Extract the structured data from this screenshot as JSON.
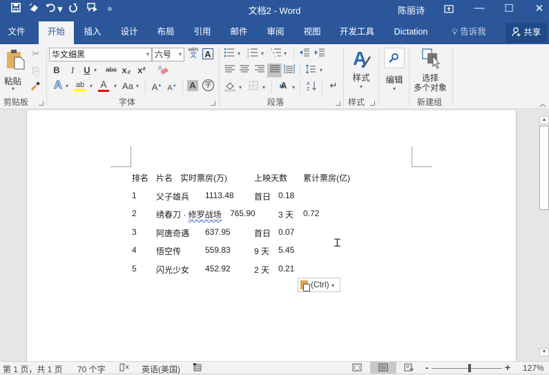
{
  "window": {
    "doc_name": "文档2",
    "separator": "-",
    "app_name": "Word",
    "user": "陈丽诗",
    "ribbon_display_icon": "ribbon-display-options-icon",
    "minimize": "—",
    "maximize": "☐",
    "close": "✕"
  },
  "qat": {
    "save": "save-icon",
    "touch_mode": "touch-mode-icon",
    "undo": "undo-icon",
    "redo": "redo-icon",
    "read_aloud": "read-aloud-icon",
    "customize": "customize-qat-icon"
  },
  "tabs": [
    {
      "label": "文件",
      "active": false
    },
    {
      "label": "开始",
      "active": true
    },
    {
      "label": "插入",
      "active": false
    },
    {
      "label": "设计",
      "active": false
    },
    {
      "label": "布局",
      "active": false
    },
    {
      "label": "引用",
      "active": false
    },
    {
      "label": "邮件",
      "active": false
    },
    {
      "label": "审阅",
      "active": false
    },
    {
      "label": "视图",
      "active": false
    },
    {
      "label": "开发工具",
      "active": false
    },
    {
      "label": "Dictation",
      "active": false
    }
  ],
  "tell_me": "告诉我",
  "share": "共享",
  "ribbon": {
    "clipboard": {
      "label": "剪贴板",
      "paste": "粘贴"
    },
    "font": {
      "label": "字体",
      "font_name": "华文细黑",
      "font_size": "六号",
      "pinyin_top": "wén",
      "pinyin_bottom": "文",
      "bold": "B",
      "italic": "I",
      "underline": "U",
      "strikethrough": "abc",
      "subscript": "x₂",
      "superscript": "x²",
      "text_effects": "A",
      "highlight": "ab",
      "font_color": "A",
      "change_case": "Aa",
      "grow": "A",
      "shrink": "A",
      "shading": "A",
      "enclose": "字",
      "char_border": "A",
      "highlight_color": "#ffff00",
      "font_color_value": "#e00000"
    },
    "paragraph": {
      "label": "段落"
    },
    "styles": {
      "label": "样式",
      "button": "样式"
    },
    "editing": {
      "button": "编辑"
    },
    "new_group": {
      "label": "新建组",
      "button_line1": "选择",
      "button_line2": "多个对象"
    }
  },
  "document": {
    "header": [
      "排名",
      "片名",
      "实时票房(万)",
      "上映天数",
      "累计票房(亿)"
    ],
    "rows": [
      {
        "rank": "1",
        "title": "父子雄兵",
        "box": "1113.48",
        "days": "首日",
        "total": "0.18"
      },
      {
        "rank": "2",
        "title_a": "绣春刀 · ",
        "title_b": "修罗战场",
        "box": "765.90",
        "days": "3 天",
        "total": "0.72"
      },
      {
        "rank": "3",
        "title": "阿唐奇遇",
        "box": "637.95",
        "days": "首日",
        "total": "0.07"
      },
      {
        "rank": "4",
        "title": "悟空传",
        "box": "559.83",
        "days": "9 天",
        "total": "5.45"
      },
      {
        "rank": "5",
        "title": "闪光少女",
        "box": "452.92",
        "days": "2 天",
        "total": "0.21"
      }
    ],
    "paste_options": "(Ctrl)"
  },
  "status": {
    "page": "第 1 页，共 1 页",
    "words": "70 个字",
    "language": "英语(美国)",
    "zoom": "127%",
    "zoom_minus": "-",
    "zoom_plus": "+",
    "zoom_percent": 127
  }
}
